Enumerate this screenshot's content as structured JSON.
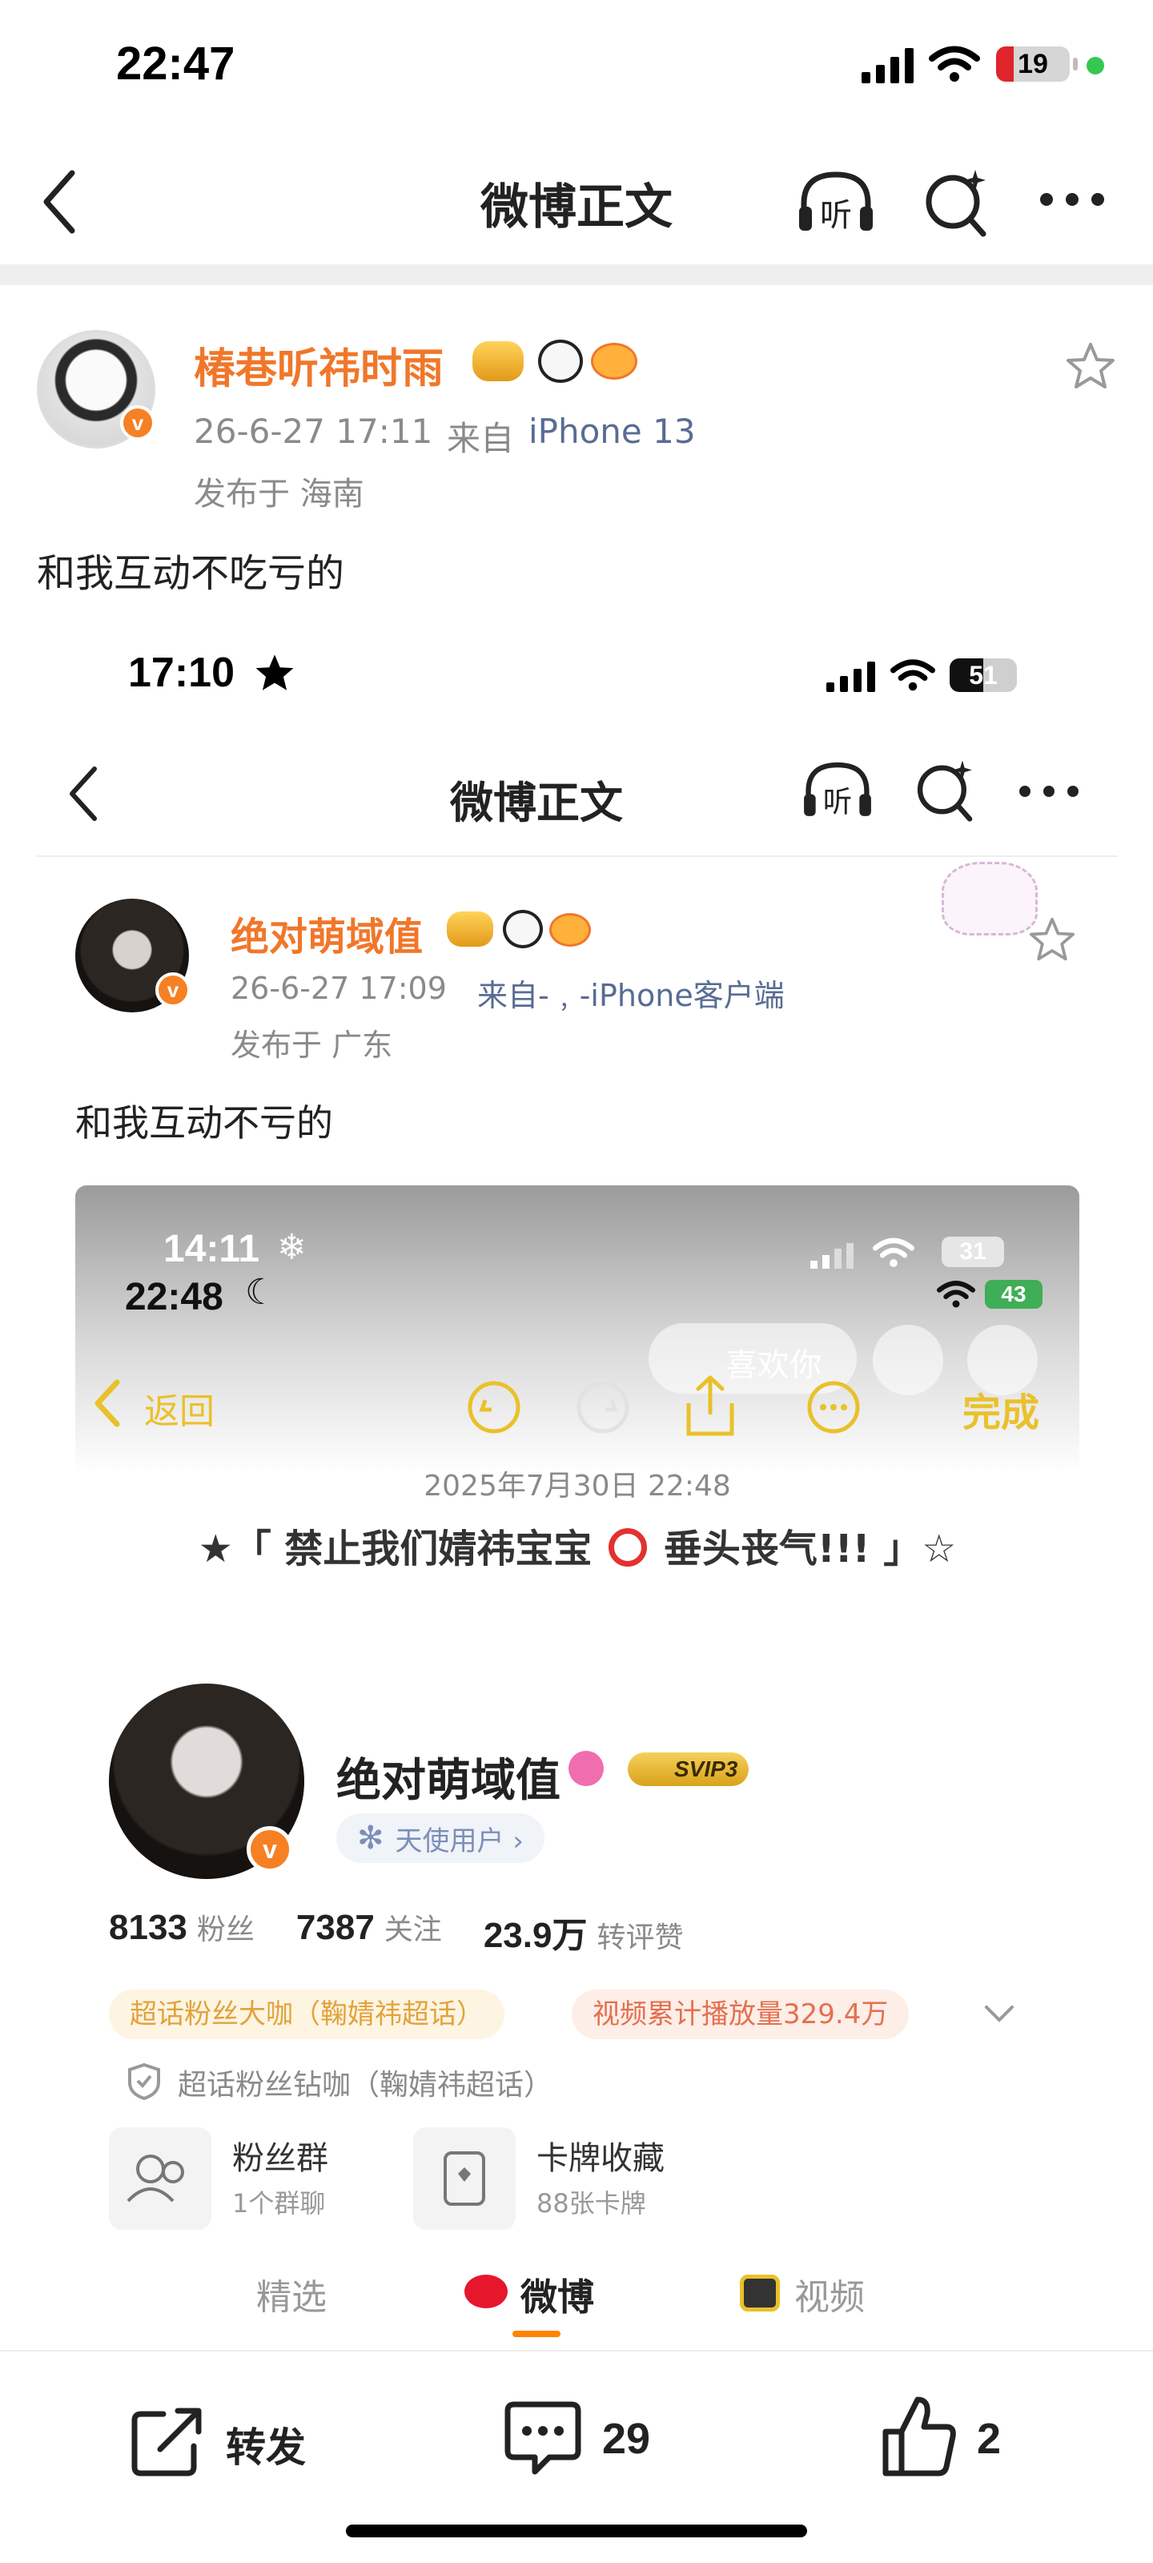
{
  "status_bar": {
    "time": "22:47",
    "battery": "19"
  },
  "nav": {
    "title": "微博正文"
  },
  "post": {
    "author": "椿巷听祎时雨",
    "time": "26-6-27 17:11",
    "from_label": "来自",
    "device": "iPhone 13",
    "location": "发布于 海南",
    "text": "和我互动不吃亏的"
  },
  "shot1": {
    "status_time": "17:10",
    "battery": "51",
    "nav_title": "微博正文",
    "author": "绝对萌域值",
    "time": "26-6-27 17:09",
    "from": "来自-﹐-iPhone客户端",
    "location": "发布于 广东",
    "text": "和我互动不亏的"
  },
  "shot2": {
    "status_time_a": "14:11",
    "status_time_b": "22:48",
    "battery_a": "31",
    "battery_b": "43",
    "like_you": "喜欢你",
    "back": "返回",
    "done": "完成",
    "date": "2025年7月30日 22:48",
    "headline": "★「 禁止我们婧祎宝宝",
    "headline_tail": "垂头丧气!!! 」☆",
    "name": "绝对萌域值",
    "svip": "SVIP3",
    "angel": "天使用户 ›",
    "stats": [
      {
        "num": "8133",
        "label": "粉丝"
      },
      {
        "num": "7387",
        "label": "关注"
      },
      {
        "num": "23.9万",
        "label": "转评赞"
      }
    ],
    "tag1": "超话粉丝大咖（鞠婧祎超话）",
    "tag2": "视频累计播放量329.4万",
    "diamond": "超话粉丝钻咖（鞠婧祎超话）",
    "group_title": "粉丝群",
    "group_sub": "1个群聊",
    "card_title": "卡牌收藏",
    "card_sub": "88张卡牌",
    "tabs": [
      "精选",
      "微博",
      "视频"
    ]
  },
  "bottom": {
    "repost": "转发",
    "comments": "29",
    "likes": "2"
  }
}
